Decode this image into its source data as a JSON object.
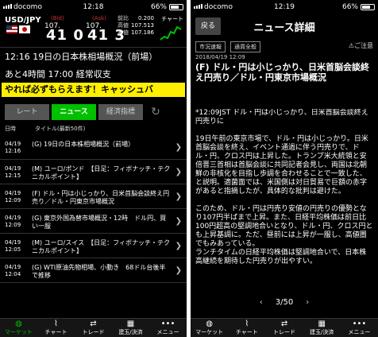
{
  "status_left": {
    "carrier": "docomo",
    "time": "12:18",
    "battery": "66%"
  },
  "status_right": {
    "carrier": "docomo",
    "time": "12:19",
    "battery": "66%"
  },
  "rate": {
    "pair": "USD/JPY",
    "bid_label": "Bid",
    "ask_label": "Ask",
    "bid_prefix": "107.",
    "bid_big": "41 0",
    "ask_prefix": "107.",
    "ask_big": "41 3",
    "stat_labels": [
      "前比",
      "高値",
      "安値"
    ],
    "stat_values": [
      "0.200",
      "107.513",
      "107.186"
    ],
    "chart_label": "チャート"
  },
  "news_header": "12:16 19日の日本株相場概況（前場）",
  "info_line": "あと4時間 17:00 経常収支",
  "banner": "やれば必ずもらえます！キャッシュバ",
  "tabs": [
    "レート",
    "ニュース",
    "経済指標"
  ],
  "columns": {
    "date": "日時",
    "title": "タイトル(最新50件)"
  },
  "news": [
    {
      "date": "04/19\n12:16",
      "title": "(G) 19日の日本株相場概況（前場）"
    },
    {
      "date": "04/19\n12:15",
      "title": "(M) ユーロ/ポンド　【日足：フィボナッチ・テクニカルポイント】"
    },
    {
      "date": "04/19\n12:09",
      "title": "(F) ドル・円は小じっかり、日米首脳会談終え円売り／ドル・円東京市場概況"
    },
    {
      "date": "04/19\n12:09",
      "title": "(G) 東京外国為替市場概況・12時　ドル円、買い一服"
    },
    {
      "date": "04/19\n12:05",
      "title": "(M) ユーロ/スイス　【日足：フィボナッチ・テクニカルポイント】"
    },
    {
      "date": "04/19\n12:04",
      "title": "(G) WTI原油先物相場、小動き　68ドル台後半で推移"
    }
  ],
  "nav": [
    {
      "icon": "globe-icon",
      "label": "マーケット"
    },
    {
      "icon": "chart-icon",
      "label": "チャート"
    },
    {
      "icon": "trade-icon",
      "label": "トレード"
    },
    {
      "icon": "position-icon",
      "label": "建玉/決済"
    },
    {
      "icon": "menu-icon",
      "label": "メニュー"
    }
  ],
  "detail": {
    "back": "戻る",
    "title": "ニュース詳細",
    "tags": [
      "市況速報",
      "通貨全般"
    ],
    "caution": "ご注意",
    "date": "2018/04/19 12:09",
    "headline": "(F) ドル・円は小じっかり、日米首脳会談終え円売り／ドル・円東京市場概況",
    "body": "*12:09JST ドル・円は小じっかり、日米首脳会談終え円売りに\n\n19日午前の東京市場で、ドル・円は小じっかり。日米首脳会談を終え、イベント通過に伴う円売りで、ドル・円、クロス円は上昇した。トランプ米大統領と安倍晋三首相は首脳会談に共同記者会見し、両国は北朝鮮の非核化を目指し歩調を合わせることで一致した、と説明。適菌面では、米国側は対日貿易で巨額の赤字があると指摘したが、具体的な批判は避けた。\n\nこのため、ドル・円は円売り安値の円売りの優勢となり107円半ばまで上昇。また、日経平均株価は前日比100円超高の堅調地合いとなり、ドル・円、クロス円とも上昇基調に。ただ、昼前には上昇が一服し、高値圏でもみあっている。\nランチタイムの日経平均株価は堅調地合いで、日本株高継続を期待した円売りが出やすい。",
    "pager": "3/50"
  }
}
